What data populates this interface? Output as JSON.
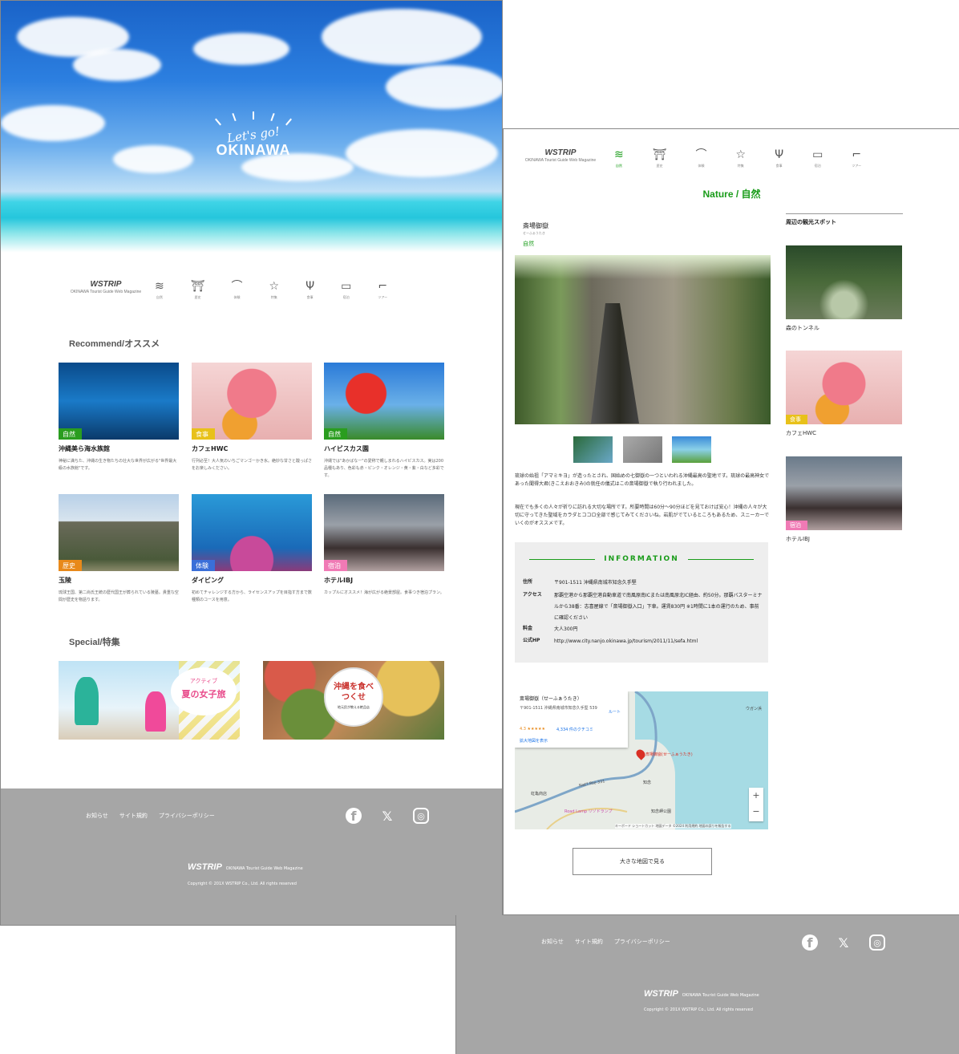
{
  "pageA": {
    "hero": {
      "lets": "Let's go!",
      "okinawa": "OKINAWA"
    },
    "logo": {
      "name": "WSTRIP",
      "sub": "OKINAWA Tourist Guide Web Magazine"
    },
    "nav": [
      {
        "label": "自然",
        "icon": "waves-icon",
        "glyph": "≋"
      },
      {
        "label": "歴史",
        "icon": "temple-icon",
        "glyph": "⛩"
      },
      {
        "label": "体験",
        "icon": "snorkel-icon",
        "glyph": "⌒"
      },
      {
        "label": "特集",
        "icon": "star-icon",
        "glyph": "☆"
      },
      {
        "label": "食事",
        "icon": "cutlery-icon",
        "glyph": "Ψ"
      },
      {
        "label": "宿泊",
        "icon": "bed-icon",
        "glyph": "▭"
      },
      {
        "label": "ツアー",
        "icon": "shoe-icon",
        "glyph": "⌐"
      }
    ],
    "recommend_title": "Recommend/オススメ",
    "cards": [
      {
        "tag": "自然",
        "tag_color": "#2a9d1f",
        "name": "沖縄美ら海水族館",
        "desc": "神秘に満ちた、沖縄の生き物たちの壮大な世界が広がる\"世界最大級の水族館\"です。"
      },
      {
        "tag": "食事",
        "tag_color": "#e8c11a",
        "name": "カフェHWC",
        "desc": "行列必至！大人気のいちごマンゴーかき氷。絶妙な甘さと酸っぱさをお楽しみください。"
      },
      {
        "tag": "自然",
        "tag_color": "#2a9d1f",
        "name": "ハイビスカス園",
        "desc": "沖縄では\"あかばなー\"の愛称で親しまれるハイビスカス。実は200品種もあり、色彩も赤・ピンク・オレンジ・黄・紫・白など多彩です。"
      },
      {
        "tag": "歴史",
        "tag_color": "#e8891a",
        "name": "玉陵",
        "desc": "琉球王国、第二尚氏王統の歴代国王が葬られている陵墓。貴重な空間が歴史を物語ります。"
      },
      {
        "tag": "体験",
        "tag_color": "#3a6fd8",
        "name": "ダイビング",
        "desc": "初めてチャレンジする方から、ライセンスアップを目指す方まで数種類のコースを用意。"
      },
      {
        "tag": "宿泊",
        "tag_color": "#f07ab5",
        "name": "ホテルIBJ",
        "desc": "カップルにオススメ！海が広がる絶景部屋。食事つき宿泊プラン。"
      }
    ],
    "special_title": "Special/特集",
    "special": [
      {
        "small": "アクティブ",
        "big": "夏の女子旅"
      },
      {
        "big": "沖縄を食べつくせ",
        "small": "地元民が教える絶品店"
      }
    ]
  },
  "pageB": {
    "page_title": "Nature / 自然",
    "spot": {
      "name": "斎場御嶽",
      "ruby": "せーふぁうたき",
      "category": "自然"
    },
    "body1": "琉球の始祖「アマミキヨ」が造ったとされ、国始めの七御嶽の一つといわれる沖縄最高の聖地です。琉球の最高神女であった聞得大君(きこえおおきみ)の就任の儀式はこの斎場御嶽で執り行われました。",
    "body2": "現在でも多くの人々が祈りに訪れる大切な場所です。所要時間は60分〜90分ほどを見ておけば安心！沖縄の人々が大切に守ってきた聖域をカラダとココロ全部で感じてみてくださいね。岩肌がでているところもあるため、スニーカーでいくのがオススメです。",
    "info": {
      "heading": "INFORMATION",
      "rows": [
        {
          "k": "住所",
          "v": "〒901-1511 沖縄県南城市知念久手堅"
        },
        {
          "k": "アクセス",
          "v": "那覇空港から那覇空港自動車道で南風原南ICまたは南風原北IC経由、約50分。那覇バスターミナルから38番：志喜屋線で「斎場御嶽入口」下車。運賃830円 ※1時間に1本の運行のため、事前に確認ください"
        },
        {
          "k": "料金",
          "v": "大人300円"
        },
        {
          "k": "公式HP",
          "v": "http://www.city.nanjo.okinawa.jp/tourism/2011/11/sefa.html"
        }
      ]
    },
    "map": {
      "place": "斎場御嶽（せーふぁうたき）",
      "addr": "〒901-1511 沖縄県南城市知念久手堅 539",
      "route": "ルート",
      "rating": "4.3 ★★★★★",
      "reviews": "4,334 件のクチコミ",
      "enlarge": "拡大地図を表示",
      "pin": "斎場御嶽(せーふぁうたき)",
      "poi1": "虹亀商店",
      "poi2": "Road Lamp リゾドランプ",
      "poi3": "ウガン浜",
      "poi4": "知念",
      "poi5": "知念岬公園",
      "road": "Nat'l Rte 331",
      "attrib": "キーボード ショートカット  地図データ ©2024  利用規約  地図の誤りを報告する",
      "zoom_in": "+",
      "zoom_out": "−"
    },
    "map_button": "大きな地図で見る",
    "side_title": "周辺の観光スポット",
    "side": [
      {
        "name": "森のトンネル"
      },
      {
        "name": "カフェHWC",
        "tag": "食事",
        "tag_color": "#e8c11a"
      },
      {
        "name": "ホテルIBJ",
        "tag": "宿泊",
        "tag_color": "#f07ab5"
      }
    ]
  },
  "footer": {
    "links": [
      "お知らせ",
      "サイト規約",
      "プライバシーポリシー"
    ],
    "social": [
      {
        "icon": "facebook-icon",
        "glyph": "f"
      },
      {
        "icon": "x-icon",
        "glyph": "𝕏"
      },
      {
        "icon": "instagram-icon",
        "glyph": "◎"
      }
    ],
    "logo": "WSTRIP",
    "logo_sub": "OKINAWA Tourist Guide Web Magazine",
    "copyright": "Copyright © 201X WSTRIP Co., Ltd. All rights reserved"
  }
}
